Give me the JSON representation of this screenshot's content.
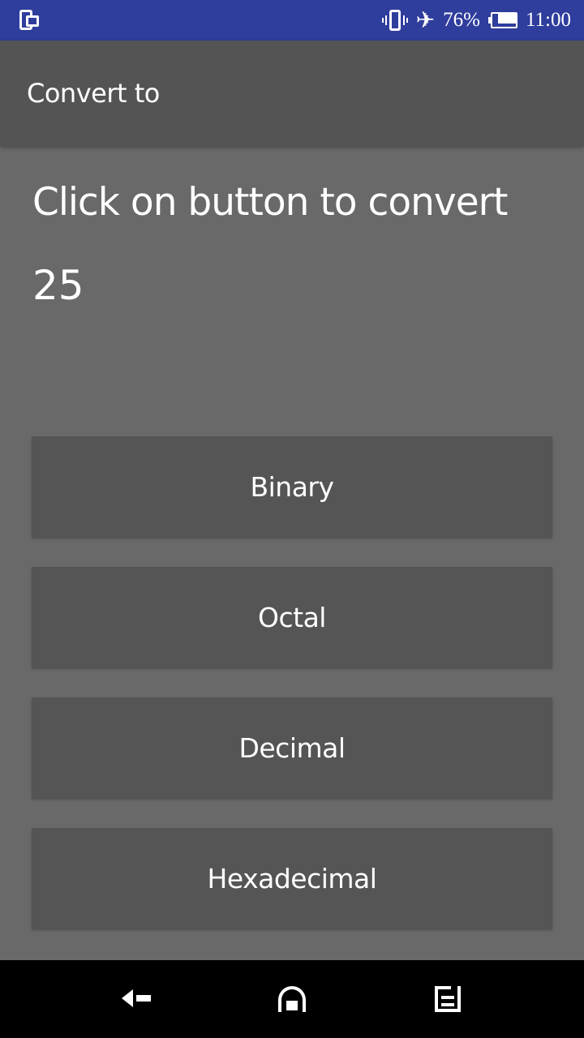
{
  "status_bar": {
    "battery_percent": 76,
    "battery_text": "76%",
    "time": "11:00",
    "background_color": "#2f3d9c",
    "icons": [
      "screen-mirror-icon",
      "vibrate-icon",
      "airplane-icon",
      "battery-icon"
    ]
  },
  "app_bar": {
    "title": "Convert to",
    "background_color": "#545454"
  },
  "main": {
    "instruction": "Click on button to convert",
    "value": "25",
    "background_color": "#696969",
    "buttons": [
      {
        "label": "Binary"
      },
      {
        "label": "Octal"
      },
      {
        "label": "Decimal"
      },
      {
        "label": "Hexadecimal"
      }
    ]
  },
  "nav_bar": {
    "icons": [
      "back-icon",
      "home-icon",
      "recent-apps-icon"
    ]
  }
}
